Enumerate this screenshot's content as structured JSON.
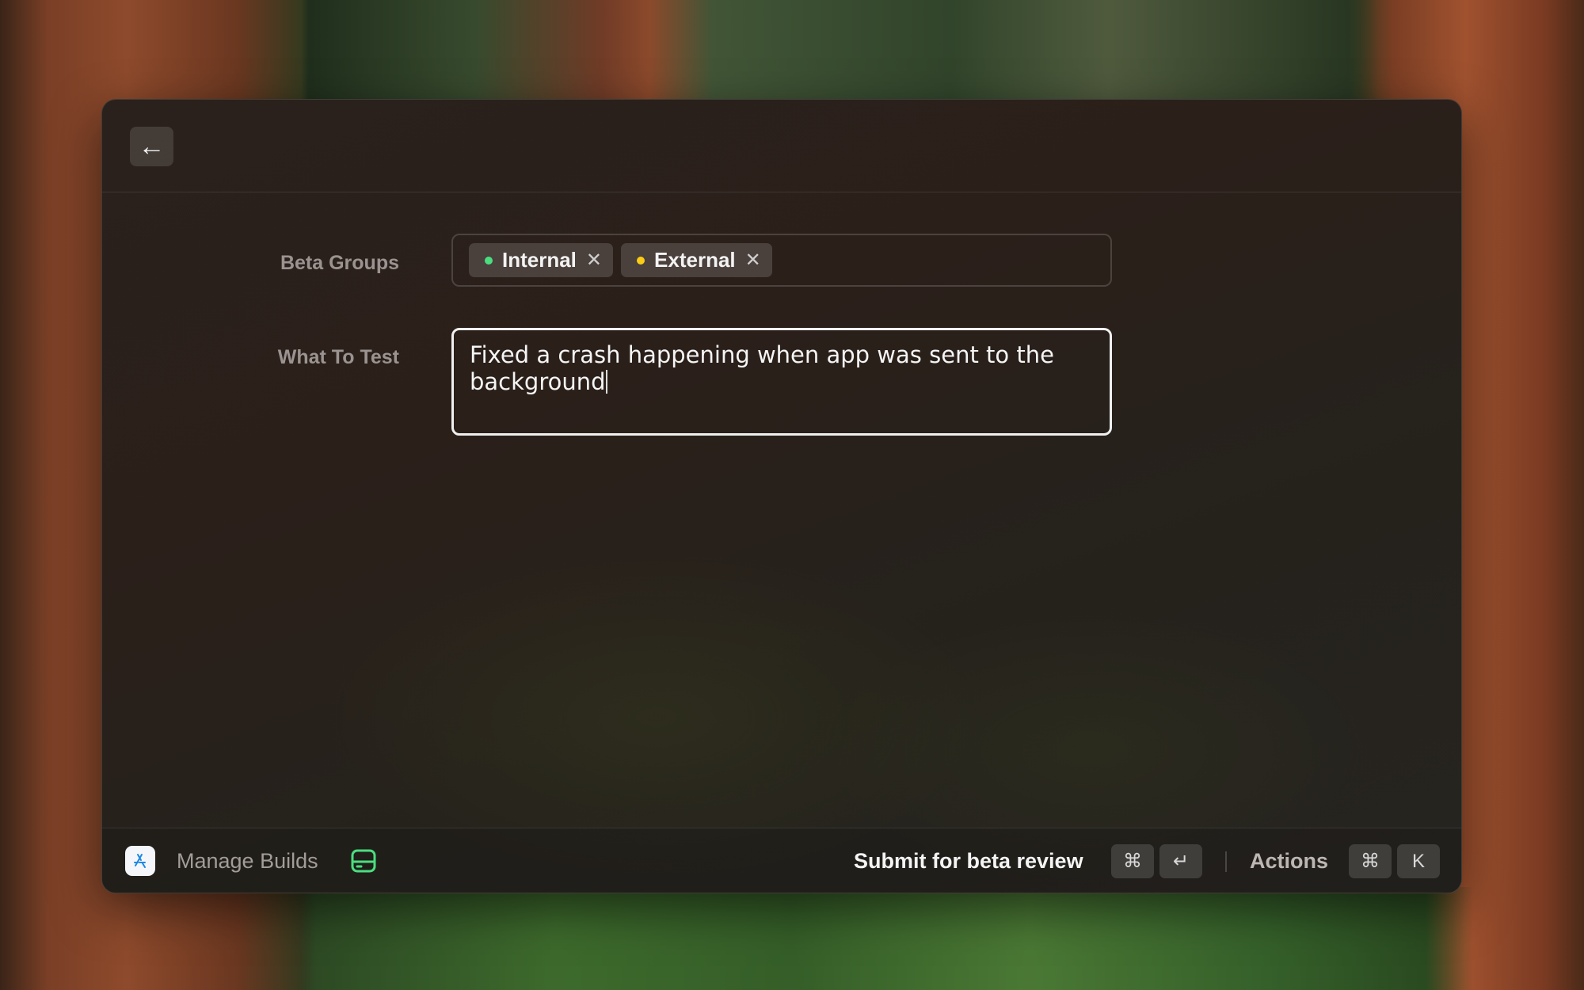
{
  "header": {
    "back_icon": "arrow-left-icon"
  },
  "form": {
    "beta_groups": {
      "label": "Beta Groups",
      "tags": [
        {
          "label": "Internal",
          "dot_color": "#4ade80"
        },
        {
          "label": "External",
          "dot_color": "#facc15"
        }
      ]
    },
    "what_to_test": {
      "label": "What To Test",
      "value": "Fixed a crash happening when app was sent to the background"
    }
  },
  "footer": {
    "app_icon": "app-store-icon",
    "title": "Manage Builds",
    "drive_icon": "drive-icon",
    "drive_icon_color": "#4ade80",
    "primary_action": "Submit for beta review",
    "primary_shortcut": [
      "⌘",
      "↵"
    ],
    "actions_label": "Actions",
    "actions_shortcut": [
      "⌘",
      "K"
    ]
  }
}
